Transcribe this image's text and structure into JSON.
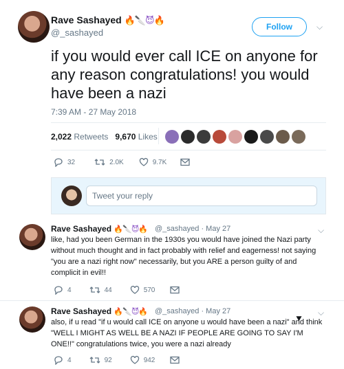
{
  "main_tweet": {
    "display_name": "Rave Sashayed",
    "handle": "@_sashayed",
    "follow_label": "Follow",
    "text": "if you would ever call ICE on anyone for any reason congratulations! you would have been a nazi",
    "timestamp": "7:39 AM - 27 May 2018",
    "retweets_count": "2,022",
    "retweets_label": "Retweets",
    "likes_count": "9,670",
    "likes_label": "Likes",
    "reply_count": "32",
    "retweet_count_short": "2.0K",
    "like_count_short": "9.7K"
  },
  "reply_box": {
    "placeholder": "Tweet your reply"
  },
  "replies": [
    {
      "display_name": "Rave Sashayed",
      "handle": "@_sashayed",
      "separator": "·",
      "date": "May 27",
      "text": "like, had you been German in the 1930s you would have joined the Nazi party without much thought and in fact probably with relief and eagerness! not saying \"you are a nazi right now\" necessarily, but you ARE a person guilty of and complicit in evil!!",
      "reply_count": "4",
      "retweet_count": "44",
      "like_count": "570"
    },
    {
      "display_name": "Rave Sashayed",
      "handle": "@_sashayed",
      "separator": "·",
      "date": "May 27",
      "text": "also, if u read \"if u would call ICE on anyone u would have been a nazi\" and think \"WELL I MIGHT AS WELL BE A NAZI IF PEOPLE ARE GOING TO SAY I'M ONE!!\" congratulations twice, you were a nazi already",
      "reply_count": "4",
      "retweet_count": "92",
      "like_count": "942"
    }
  ],
  "colors": {
    "accent": "#1da1f2",
    "muted": "#657786",
    "text": "#14171a",
    "divider": "#e6ecf0"
  }
}
